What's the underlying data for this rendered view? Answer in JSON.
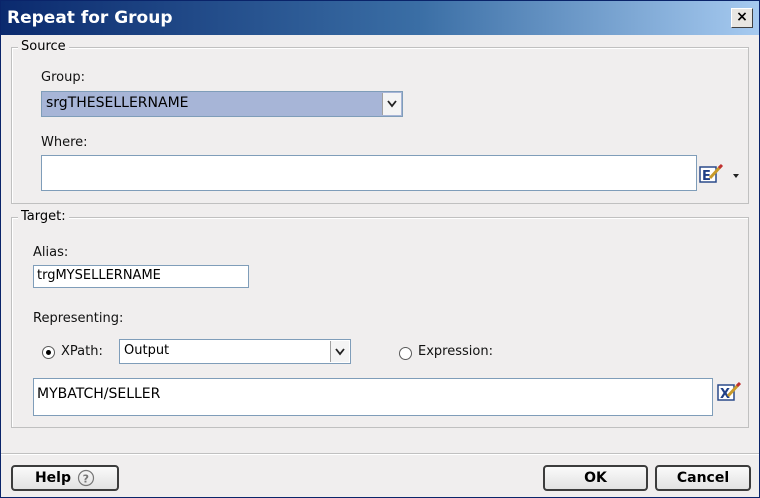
{
  "dialog": {
    "title": "Repeat for Group",
    "close_glyph": "×"
  },
  "source": {
    "legend": "Source",
    "group_label": "Group:",
    "group_value": "srgTHESELLERNAME",
    "where_label": "Where:",
    "where_value": ""
  },
  "target": {
    "legend": "Target:",
    "alias_label": "Alias:",
    "alias_value": "trgMYSELLERNAME",
    "representing_label": "Representing:",
    "xpath_label": "XPath:",
    "xpath_selected": true,
    "xpath_type_value": "Output",
    "expression_label": "Expression:",
    "expression_selected": false,
    "path_value": "MYBATCH/SELLER"
  },
  "buttons": {
    "help": "Help",
    "ok": "OK",
    "cancel": "Cancel"
  },
  "colors": {
    "title_start": "#0b2a6e",
    "title_end": "#a6caf0",
    "group_selected_bg": "#a7b5d7",
    "dialog_bg": "#f0eeee"
  },
  "icons": [
    "close-icon",
    "edit-expression-icon",
    "dropdown-arrow-icon",
    "chevron-down-icon",
    "help-circle-icon",
    "edit-xpath-icon"
  ]
}
